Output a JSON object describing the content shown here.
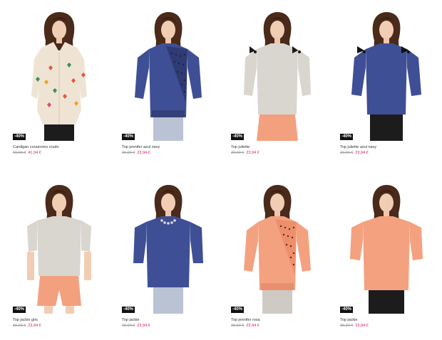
{
  "colors": {
    "price_new": "#e0106b",
    "price_old": "#999999",
    "badge": "#111111"
  },
  "products": [
    {
      "name": "Cardigan corazones crudo",
      "old_price": "69,90 €",
      "new_price": "41,94 €",
      "discount": "-40%",
      "garment": "cream knit cardigan with multicolor hearts",
      "bottom": "black trousers"
    },
    {
      "name": "Top jennifer azul navy",
      "old_price": "39,90 €",
      "new_price": "23,94 €",
      "discount": "-40%",
      "garment": "navy top with polka-dot diagonal panel",
      "bottom": "light blue skirt"
    },
    {
      "name": "Top juliette",
      "old_price": "39,90 €",
      "new_price": "23,94 €",
      "discount": "-40%",
      "garment": "grey top with black shoulder bows",
      "bottom": "salmon skirt"
    },
    {
      "name": "Top juliette azul navy",
      "old_price": "39,90 €",
      "new_price": "23,94 €",
      "discount": "-40%",
      "garment": "navy top with black shoulder bows",
      "bottom": "black trousers"
    },
    {
      "name": "Top jackie gris",
      "old_price": "39,90 €",
      "new_price": "23,94 €",
      "discount": "-40%",
      "garment": "grey oversized top",
      "bottom": "salmon shorts"
    },
    {
      "name": "Top jackie",
      "old_price": "39,90 €",
      "new_price": "23,94 €",
      "discount": "-40%",
      "garment": "navy top with embellished neckline",
      "bottom": "light blue skirt"
    },
    {
      "name": "Top jennifer rosa",
      "old_price": "39,90 €",
      "new_price": "23,94 €",
      "discount": "-40%",
      "garment": "coral top with polka-dot diagonal panel",
      "bottom": "grey skirt"
    },
    {
      "name": "Top jackie",
      "old_price": "39,90 €",
      "new_price": "23,94 €",
      "discount": "-40%",
      "garment": "coral oversized top",
      "bottom": "black skirt"
    }
  ]
}
